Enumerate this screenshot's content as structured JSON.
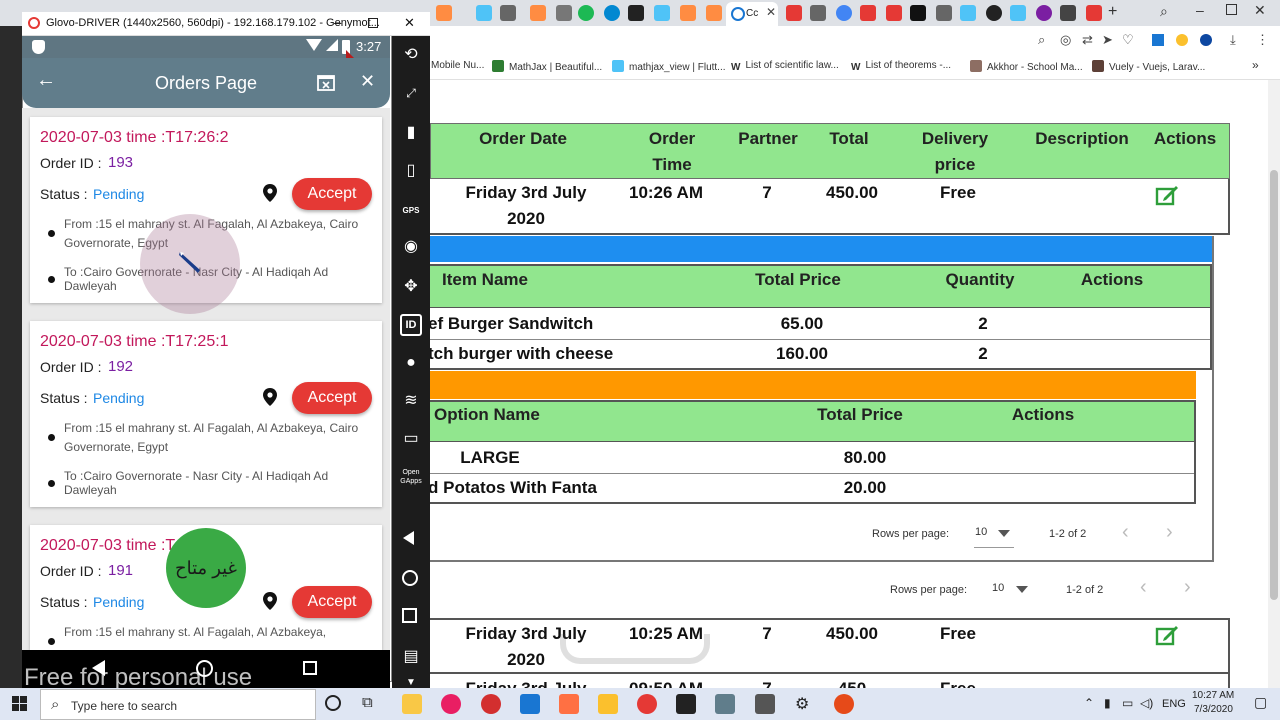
{
  "browser": {
    "tabs_visible_title": "Cc",
    "bookmarks": [
      "Mobile Nu...",
      "MathJax | Beautiful...",
      "mathjax_view | Flutt...",
      "List of scientific law...",
      "List of theorems -...",
      "Akkhor - School Ma...",
      "Vuely - Vuejs, Larav..."
    ],
    "more_bookmarks": "»"
  },
  "orders_table": {
    "headers": [
      "Order Date",
      "Order\nTime",
      "Partner",
      "Total",
      "Delivery\nprice",
      "Description",
      "Actions"
    ],
    "header_lines": {
      "order_date": "Order Date",
      "order_time_1": "Order",
      "order_time_2": "Time",
      "partner": "Partner",
      "total": "Total",
      "delivery_1": "Delivery",
      "delivery_2": "price",
      "description": "Description",
      "actions": "Actions"
    },
    "rows": [
      {
        "date_1": "Friday 3rd July",
        "date_2": "2020",
        "time": "10:26 AM",
        "partner": "7",
        "total": "450.00",
        "delivery": "Free"
      },
      {
        "date_1": "Friday 3rd July",
        "date_2": "2020",
        "time": "10:25 AM",
        "partner": "7",
        "total": "450.00",
        "delivery": "Free"
      },
      {
        "date_1": "Friday 3rd July",
        "time": "09:50 AM",
        "partner": "7",
        "total": "450",
        "delivery": "Free"
      }
    ]
  },
  "items_table": {
    "headers": {
      "item_name": "Item Name",
      "total_price": "Total Price",
      "quantity": "Quantity",
      "actions": "Actions"
    },
    "rows": [
      {
        "name": "ef Burger Sandwitch",
        "price": "65.00",
        "qty": "2"
      },
      {
        "name": "tch burger with cheese",
        "price": "160.00",
        "qty": "2"
      }
    ]
  },
  "options_table": {
    "headers": {
      "option_name": "Option Name",
      "total_price": "Total Price",
      "actions": "Actions"
    },
    "rows": [
      {
        "name": "LARGE",
        "price": "80.00"
      },
      {
        "name": "d Potatos With Fanta",
        "price": "20.00"
      }
    ]
  },
  "pagers": [
    {
      "label": "Rows per page:",
      "value": "10",
      "range": "1-2 of 2"
    },
    {
      "label": "Rows per page:",
      "value": "10",
      "range": "1-2 of 2"
    }
  ],
  "emulator": {
    "window_title": "Glovo-DRIVER (1440x2560, 560dpi) - 192.168.179.102 - Genymot...",
    "clock": "3:27",
    "debug_banner": "DEBUG",
    "app_title": "Orders Page",
    "watermark_text": "Free for personal use",
    "unavailable_badge": "غير متاح"
  },
  "orders": [
    {
      "date": "2020-07-03 time :T17:26:2",
      "order_id_label": "Order ID :",
      "order_id": "193",
      "status_label": "Status :",
      "status": "Pending",
      "accept": "Accept",
      "from": "From :15 el mahrany st. Al Fagalah, Al Azbakeya, Cairo Governorate, Egypt",
      "to": "To :Cairo Governorate - Nasr City - Al Hadiqah Ad Dawleyah"
    },
    {
      "date": "2020-07-03 time :T17:25:1",
      "order_id_label": "Order ID :",
      "order_id": "192",
      "status_label": "Status :",
      "status": "Pending",
      "accept": "Accept",
      "from": "From :15 el mahrany st. Al Fagalah, Al Azbakeya, Cairo Governorate, Egypt",
      "to": "To :Cairo Governorate - Nasr City - Al Hadiqah Ad Dawleyah"
    },
    {
      "date": "2020-07-03 time :T",
      "order_id_label": "Order ID :",
      "order_id": "191",
      "status_label": "Status :",
      "status": "Pending",
      "accept": "Accept",
      "from": "From :15 el mahrany st. Al Fagalah, Al Azbakeya,"
    }
  ],
  "taskbar": {
    "search_placeholder": "Type here to search",
    "language": "ENG",
    "time": "10:27 AM",
    "date": "7/3/2020"
  },
  "colors": {
    "table_header": "#91e68e",
    "blue_bar": "#1e8ef0",
    "orange_bar": "#ff9800",
    "accept": "#e53935",
    "app_bar": "#617d8b",
    "order_date": "#c2185b"
  }
}
